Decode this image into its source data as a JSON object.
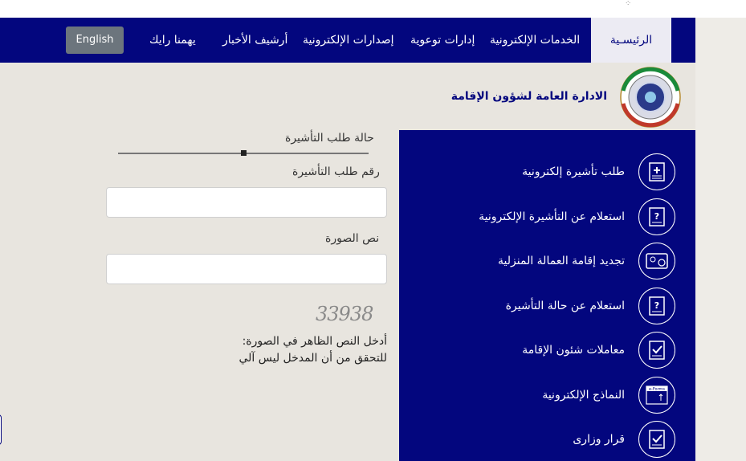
{
  "nav": {
    "items": [
      {
        "label": "الرئيسـية",
        "active": true
      },
      {
        "label": "الخدمات الإلكترونية",
        "active": false
      },
      {
        "label": "إدارات توعوية",
        "active": false
      },
      {
        "label": "إصدارات الإلكترونية",
        "active": false
      },
      {
        "label": "أرشيف الأخبار",
        "active": false
      },
      {
        "label": "يهمنا رايك",
        "active": false
      }
    ],
    "language_button": "English"
  },
  "header": {
    "title": "الادارة العامة لشؤون الإقامة",
    "logo_icon": "ministry-emblem-icon"
  },
  "form": {
    "status_label": "حالة طلب التأشيرة",
    "slider_value_fraction": 0.5,
    "visa_number_label": "رقم طلب التأشيرة",
    "visa_number_value": "",
    "captcha_label": "نص الصورة",
    "captcha_value": "",
    "captcha_image_text": "33938",
    "hint_line1": "أدخل النص الظاهر في الصورة:",
    "hint_line2": "للتحقق من أن المدخل ليس آلي"
  },
  "services": [
    {
      "label": "طلب تأشيرة إلكترونية",
      "icon": "document-add-icon"
    },
    {
      "label": "استعلام عن التأشيرة الإلكترونية",
      "icon": "document-question-icon"
    },
    {
      "label": "تجديد إقامة العمالة المنزلية",
      "icon": "card-renew-icon"
    },
    {
      "label": "استعلام عن حالة التأشيرة",
      "icon": "document-question-icon"
    },
    {
      "label": "معاملات شئون الإقامة",
      "icon": "document-check-icon"
    },
    {
      "label": "النماذج الإلكترونية",
      "icon": "eforms-icon"
    },
    {
      "label": "قرار وزارى",
      "icon": "document-check-icon"
    }
  ],
  "colors": {
    "primary": "#03067e",
    "background": "#e8e5df",
    "active_tab_bg": "#ecebf3",
    "button_gray": "#6c757d"
  }
}
